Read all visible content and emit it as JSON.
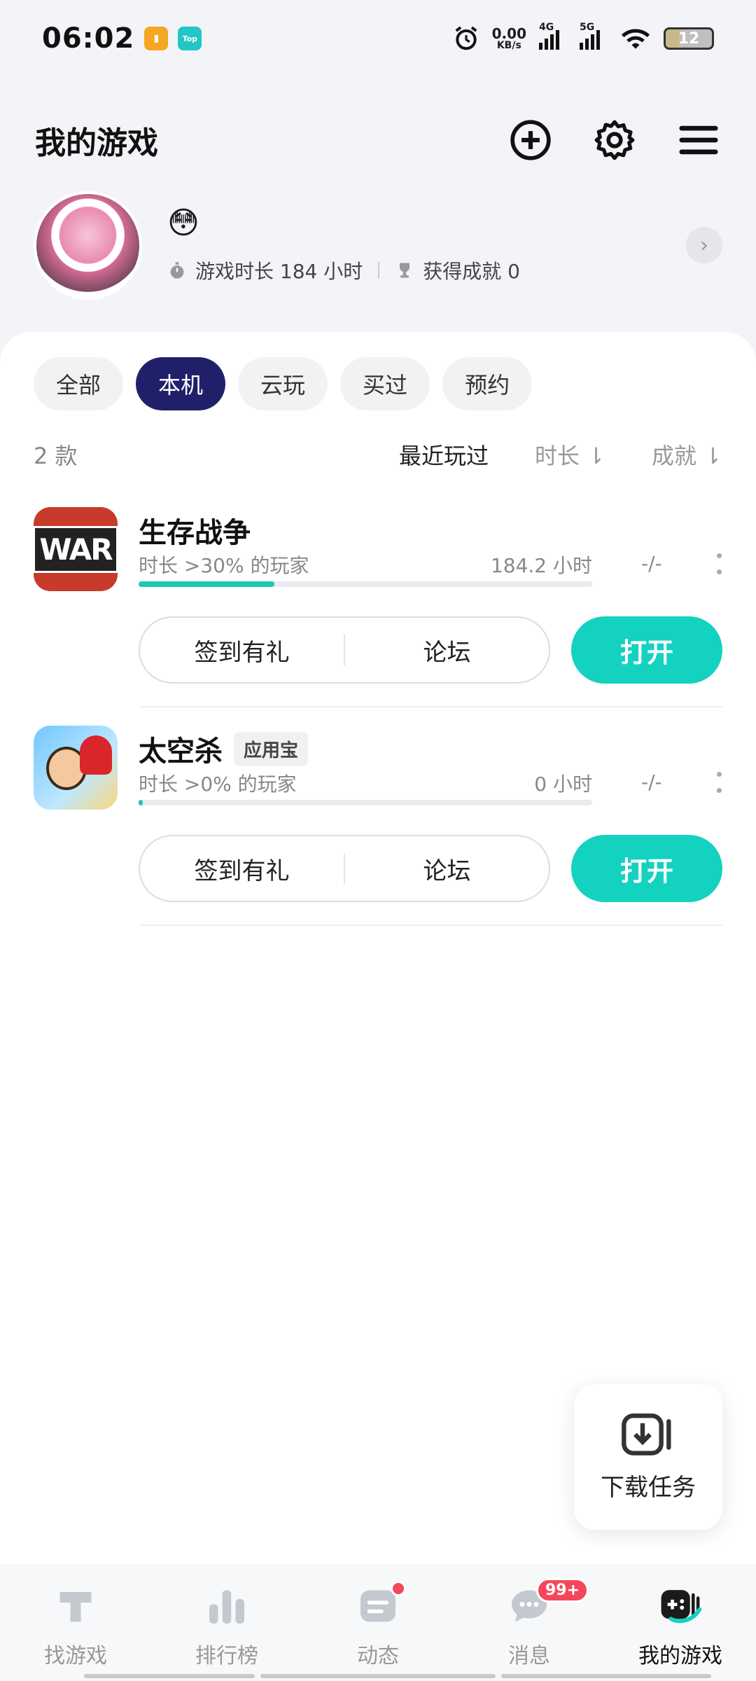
{
  "status_bar": {
    "time": "06:02",
    "net_speed": "0.00",
    "net_unit": "KB/s",
    "sig1": "4G",
    "sig2": "5G",
    "battery": "12",
    "app1_icon": "notification-app-icon",
    "app2_label": "Top"
  },
  "header": {
    "title": "我的游戏",
    "icons": [
      "add-circle-icon",
      "gear-icon",
      "menu-icon"
    ]
  },
  "profile": {
    "emoji": "😳",
    "play_time": "游戏时长 184 小时",
    "achievements": "获得成就 0"
  },
  "tabs": [
    {
      "label": "全部",
      "active": false
    },
    {
      "label": "本机",
      "active": true
    },
    {
      "label": "云玩",
      "active": false
    },
    {
      "label": "买过",
      "active": false
    },
    {
      "label": "预约",
      "active": false
    }
  ],
  "sort": {
    "count": "2 款",
    "recent": "最近玩过",
    "duration": "时长 ⇂",
    "achievement": "成就 ⇂"
  },
  "games": [
    {
      "name": "生存战争",
      "icon_text": "WAR",
      "tag": "",
      "subtitle": "时长 >30% 的玩家",
      "hours": "184.2 小时",
      "progress": 0.3,
      "achievement": "-/-",
      "btn_signin": "签到有礼",
      "btn_forum": "论坛",
      "btn_open": "打开"
    },
    {
      "name": "太空杀",
      "tag": "应用宝",
      "subtitle": "时长 >0% 的玩家",
      "hours": "0 小时",
      "progress": 0.0,
      "achievement": "-/-",
      "btn_signin": "签到有礼",
      "btn_forum": "论坛",
      "btn_open": "打开"
    }
  ],
  "download_fab": {
    "label": "下载任务"
  },
  "bottom_nav": [
    {
      "label": "找游戏",
      "active": false
    },
    {
      "label": "排行榜",
      "active": false
    },
    {
      "label": "动态",
      "active": false
    },
    {
      "label": "消息",
      "active": false,
      "badge": "99+"
    },
    {
      "label": "我的游戏",
      "active": true
    }
  ],
  "colors": {
    "accent": "#14d2c0",
    "tab_active": "#20206a",
    "badge": "#f5475c"
  }
}
